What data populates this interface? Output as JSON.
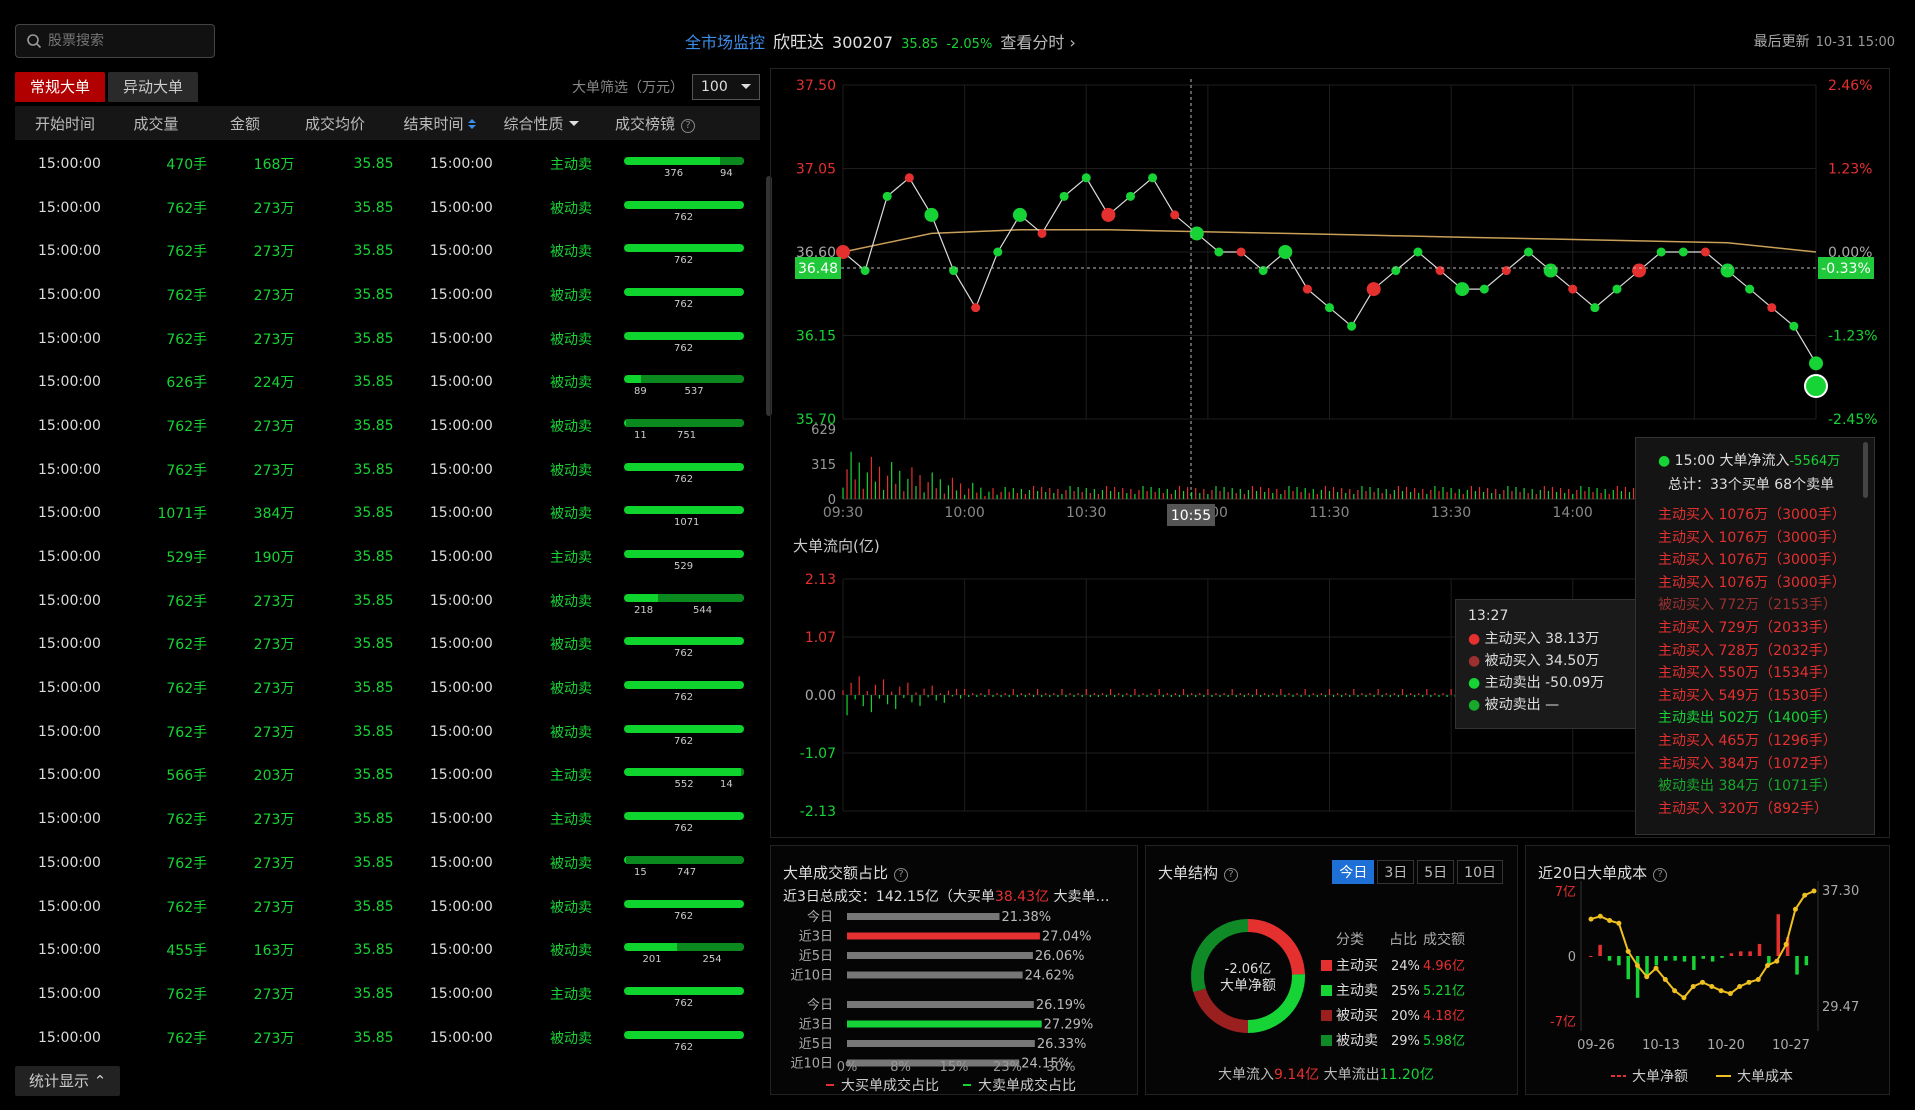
{
  "top": {
    "search_placeholder": "股票搜索",
    "market_link": "全市场监控",
    "stock_name": "欣旺达",
    "stock_code": "300207",
    "price": "35.85",
    "change": "-2.05%",
    "view_timeshare": "查看分时",
    "last_update_label": "最后更新",
    "last_update_time": "10-31 15:00"
  },
  "tabs": [
    "常规大单",
    "异动大单"
  ],
  "filter": {
    "label": "大单筛选（万元）",
    "value": "100"
  },
  "table": {
    "headers": [
      "开始时间",
      "成交量",
      "金额",
      "成交均价",
      "结束时间",
      "综合性质",
      "成交榜镜"
    ],
    "rows": [
      {
        "start": "15:00:00",
        "vol": "470手",
        "amt": "168万",
        "price": "35.85",
        "end": "15:00:00",
        "nature": "主动卖",
        "buy": 376,
        "sell": 94,
        "total": 470
      },
      {
        "start": "15:00:00",
        "vol": "762手",
        "amt": "273万",
        "price": "35.85",
        "end": "15:00:00",
        "nature": "被动卖",
        "buy": 762,
        "sell": 0,
        "total": 762
      },
      {
        "start": "15:00:00",
        "vol": "762手",
        "amt": "273万",
        "price": "35.85",
        "end": "15:00:00",
        "nature": "被动卖",
        "buy": 762,
        "sell": 0,
        "total": 762
      },
      {
        "start": "15:00:00",
        "vol": "762手",
        "amt": "273万",
        "price": "35.85",
        "end": "15:00:00",
        "nature": "被动卖",
        "buy": 762,
        "sell": 0,
        "total": 762
      },
      {
        "start": "15:00:00",
        "vol": "762手",
        "amt": "273万",
        "price": "35.85",
        "end": "15:00:00",
        "nature": "被动卖",
        "buy": 762,
        "sell": 0,
        "total": 762
      },
      {
        "start": "15:00:00",
        "vol": "626手",
        "amt": "224万",
        "price": "35.85",
        "end": "15:00:00",
        "nature": "被动卖",
        "buy": 89,
        "sell": 537,
        "total": 626
      },
      {
        "start": "15:00:00",
        "vol": "762手",
        "amt": "273万",
        "price": "35.85",
        "end": "15:00:00",
        "nature": "被动卖",
        "buy": 11,
        "sell": 751,
        "total": 762
      },
      {
        "start": "15:00:00",
        "vol": "762手",
        "amt": "273万",
        "price": "35.85",
        "end": "15:00:00",
        "nature": "被动卖",
        "buy": 762,
        "sell": 0,
        "total": 762
      },
      {
        "start": "15:00:00",
        "vol": "1071手",
        "amt": "384万",
        "price": "35.85",
        "end": "15:00:00",
        "nature": "被动卖",
        "buy": 1071,
        "sell": 0,
        "total": 1071
      },
      {
        "start": "15:00:00",
        "vol": "529手",
        "amt": "190万",
        "price": "35.85",
        "end": "15:00:00",
        "nature": "主动卖",
        "buy": 529,
        "sell": 0,
        "total": 529
      },
      {
        "start": "15:00:00",
        "vol": "762手",
        "amt": "273万",
        "price": "35.85",
        "end": "15:00:00",
        "nature": "被动卖",
        "buy": 218,
        "sell": 544,
        "total": 762
      },
      {
        "start": "15:00:00",
        "vol": "762手",
        "amt": "273万",
        "price": "35.85",
        "end": "15:00:00",
        "nature": "被动卖",
        "buy": 762,
        "sell": 0,
        "total": 762
      },
      {
        "start": "15:00:00",
        "vol": "762手",
        "amt": "273万",
        "price": "35.85",
        "end": "15:00:00",
        "nature": "被动卖",
        "buy": 762,
        "sell": 0,
        "total": 762
      },
      {
        "start": "15:00:00",
        "vol": "762手",
        "amt": "273万",
        "price": "35.85",
        "end": "15:00:00",
        "nature": "被动卖",
        "buy": 762,
        "sell": 0,
        "total": 762
      },
      {
        "start": "15:00:00",
        "vol": "566手",
        "amt": "203万",
        "price": "35.85",
        "end": "15:00:00",
        "nature": "主动卖",
        "buy": 552,
        "sell": 14,
        "total": 566
      },
      {
        "start": "15:00:00",
        "vol": "762手",
        "amt": "273万",
        "price": "35.85",
        "end": "15:00:00",
        "nature": "主动卖",
        "buy": 762,
        "sell": 0,
        "total": 762
      },
      {
        "start": "15:00:00",
        "vol": "762手",
        "amt": "273万",
        "price": "35.85",
        "end": "15:00:00",
        "nature": "被动卖",
        "buy": 15,
        "sell": 747,
        "total": 762
      },
      {
        "start": "15:00:00",
        "vol": "762手",
        "amt": "273万",
        "price": "35.85",
        "end": "15:00:00",
        "nature": "被动卖",
        "buy": 762,
        "sell": 0,
        "total": 762
      },
      {
        "start": "15:00:00",
        "vol": "455手",
        "amt": "163万",
        "price": "35.85",
        "end": "15:00:00",
        "nature": "被动卖",
        "buy": 201,
        "sell": 254,
        "total": 455
      },
      {
        "start": "15:00:00",
        "vol": "762手",
        "amt": "273万",
        "price": "35.85",
        "end": "15:00:00",
        "nature": "主动卖",
        "buy": 762,
        "sell": 0,
        "total": 762
      },
      {
        "start": "15:00:00",
        "vol": "762手",
        "amt": "273万",
        "price": "35.85",
        "end": "15:00:00",
        "nature": "被动卖",
        "buy": 762,
        "sell": 0,
        "total": 762
      }
    ]
  },
  "stat_button": "统计显示",
  "chart_data": [
    {
      "type": "scatter",
      "y_ticks": [
        "37.50",
        "37.05",
        "36.60",
        "36.15",
        "35.70"
      ],
      "pct_ticks": [
        "2.46%",
        "1.23%",
        "0.00%",
        "-1.23%",
        "-2.45%"
      ],
      "ylim": [
        35.7,
        37.5
      ],
      "current_price_label": "36.48",
      "current_pct_label": "-0.33%",
      "series": [
        {
          "values": [
            36.6,
            36.5,
            36.9,
            37.0,
            36.8,
            36.5,
            36.3,
            36.6,
            36.8,
            36.7,
            36.9,
            37.0,
            36.8,
            36.9,
            37.0,
            36.8,
            36.7,
            36.6,
            36.6,
            36.5,
            36.6,
            36.4,
            36.3,
            36.2,
            36.4,
            36.5,
            36.6,
            36.5,
            36.4,
            36.4,
            36.5,
            36.6,
            36.5,
            36.4,
            36.3,
            36.4,
            36.5,
            36.6,
            36.6,
            36.6,
            36.5,
            36.4,
            36.3,
            36.2,
            36.0
          ]
        },
        {
          "values": [
            36.6,
            36.7,
            36.72,
            36.72,
            36.71,
            36.7,
            36.69,
            36.68,
            36.67,
            36.66,
            36.65,
            36.6
          ]
        }
      ]
    },
    {
      "type": "bar",
      "x_ticks": [
        "09:30",
        "10:00",
        "10:30",
        "11:00",
        "11:30",
        "13:30",
        "14:00"
      ],
      "y_ticks": [
        "629",
        "315",
        "0"
      ],
      "cursor_time": "10:55"
    },
    {
      "type": "bar",
      "title": "大单流向(亿)",
      "y_ticks": [
        "2.13",
        "1.07",
        "0.00",
        "-1.07",
        "-2.13"
      ],
      "ylim": [
        -2.13,
        2.13
      ]
    },
    {
      "type": "bar",
      "title": "大单成交额占比",
      "total_line": "近3日总成交：142.15亿（大买单",
      "total_buy": "38.43亿",
      "total_tail": "大卖单…",
      "categories": [
        "今日",
        "近3日",
        "近5日",
        "近10日",
        "今日",
        "近3日",
        "近5日",
        "近10日"
      ],
      "values": [
        21.38,
        27.04,
        26.06,
        24.62,
        26.19,
        27.29,
        26.33,
        24.15
      ],
      "labels": [
        "21.38%",
        "27.04%",
        "26.06%",
        "24.62%",
        "26.19%",
        "27.29%",
        "26.33%",
        "24.15%"
      ],
      "x_ticks": [
        "0%",
        "8%",
        "15%",
        "23%",
        "30%"
      ],
      "xlim": [
        0,
        30
      ],
      "legend": [
        "大买单成交占比",
        "大卖单成交占比"
      ]
    },
    {
      "type": "pie",
      "title": "大单结构",
      "center_value": "-2.06亿",
      "center_label": "大单净额",
      "header": [
        "分类",
        "占比",
        "成交额"
      ],
      "categories": [
        "主动买",
        "主动卖",
        "被动买",
        "被动卖"
      ],
      "values": [
        24,
        25,
        20,
        29
      ],
      "pct_labels": [
        "24%",
        "25%",
        "20%",
        "29%"
      ],
      "amounts": [
        "4.96亿",
        "5.21亿",
        "4.18亿",
        "5.98亿"
      ],
      "colors": [
        "#e53030",
        "#17d436",
        "#9a1f1f",
        "#0f8a26"
      ],
      "period_tabs": [
        "今日",
        "3日",
        "5日",
        "10日"
      ],
      "inflow_label": "大单流入",
      "inflow_value": "9.14亿",
      "outflow_label": "大单流出",
      "outflow_value": "11.20亿"
    },
    {
      "type": "line",
      "title": "近20日大单成本",
      "y_left_ticks": [
        "7亿",
        "0",
        "-7亿"
      ],
      "y_right_ticks": [
        "37.30",
        "29.47"
      ],
      "x_ticks": [
        "09-26",
        "10-13",
        "10-20",
        "10-27"
      ],
      "legend": [
        "大单净额",
        "大单成本"
      ],
      "net_values": [
        0,
        1.2,
        -0.5,
        -1.0,
        -2.5,
        -4.5,
        -2.0,
        -1.0,
        -0.5,
        -0.5,
        -0.6,
        -1.5,
        -0.3,
        -0.6,
        -0.2,
        0.3,
        0.5,
        0.5,
        1.3,
        -1.0,
        4.5,
        2.0,
        -2.0,
        -1.0
      ],
      "cost_values": [
        35.3,
        35.5,
        35.2,
        35.0,
        33.0,
        32.0,
        31.2,
        31.8,
        31.0,
        30.2,
        29.7,
        30.5,
        30.8,
        30.5,
        30.2,
        30.0,
        30.5,
        30.8,
        31.0,
        32.0,
        32.3,
        33.5,
        36.0,
        37.0,
        37.3
      ]
    }
  ],
  "tooltip_right": {
    "title_time": "15:00",
    "title_label": "大单净流入",
    "title_value": "-5564万",
    "summary": "总计：33个买单 68个卖单",
    "items": [
      {
        "text": "主动买入 1076万（3000手）",
        "color": "#e53030"
      },
      {
        "text": "主动买入 1076万（3000手）",
        "color": "#e53030"
      },
      {
        "text": "主动买入 1076万（3000手）",
        "color": "#e53030"
      },
      {
        "text": "主动买入 1076万（3000手）",
        "color": "#e53030"
      },
      {
        "text": "被动买入 772万（2153手）",
        "color": "#9a3030"
      },
      {
        "text": "主动买入 729万（2033手）",
        "color": "#e53030"
      },
      {
        "text": "主动买入 728万（2032手）",
        "color": "#e53030"
      },
      {
        "text": "主动买入 550万（1534手）",
        "color": "#e53030"
      },
      {
        "text": "主动买入 549万（1530手）",
        "color": "#e53030"
      },
      {
        "text": "主动卖出 502万（1400手）",
        "color": "#17d436"
      },
      {
        "text": "主动买入 465万（1296手）",
        "color": "#e53030"
      },
      {
        "text": "主动买入 384万（1072手）",
        "color": "#e53030"
      },
      {
        "text": "被动卖出 384万（1071手）",
        "color": "#17a82c"
      },
      {
        "text": "主动买入 320万（892手）",
        "color": "#e53030"
      }
    ]
  },
  "tooltip_mid": {
    "time": "13:27",
    "items": [
      {
        "label": "主动买入",
        "value": "38.13万",
        "color": "#e53030"
      },
      {
        "label": "被动买入",
        "value": "34.50万",
        "color": "#9a3030"
      },
      {
        "label": "主动卖出",
        "value": "-50.09万",
        "color": "#17d436"
      },
      {
        "label": "被动卖出",
        "value": "—",
        "color": "#17a82c"
      }
    ]
  }
}
